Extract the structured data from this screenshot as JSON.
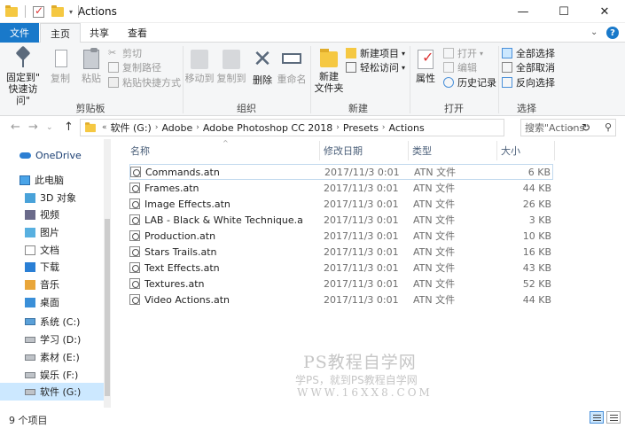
{
  "window": {
    "title": "Actions",
    "minimize": "—",
    "maximize": "☐",
    "close": "✕"
  },
  "tabs": {
    "file": "文件",
    "home": "主页",
    "share": "共享",
    "view": "查看"
  },
  "ribbon": {
    "clipboard": {
      "pin_label_1": "固定到\"",
      "pin_label_2": "快速访问\"",
      "copy": "复制",
      "paste": "粘贴",
      "cut": "剪切",
      "copy_path": "复制路径",
      "paste_shortcut": "粘贴快捷方式",
      "group": "剪贴板"
    },
    "organize": {
      "move_to": "移动到",
      "copy_to": "复制到",
      "delete": "删除",
      "rename": "重命名",
      "group": "组织"
    },
    "new": {
      "new_folder_1": "新建",
      "new_folder_2": "文件夹",
      "new_item": "新建项目",
      "easy_access": "轻松访问",
      "group": "新建"
    },
    "open": {
      "properties": "属性",
      "open": "打开",
      "edit": "编辑",
      "history": "历史记录",
      "group": "打开"
    },
    "select": {
      "select_all": "全部选择",
      "select_none": "全部取消",
      "invert": "反向选择",
      "group": "选择"
    }
  },
  "address": {
    "crumbs": [
      "软件 (G:)",
      "Adobe",
      "Adobe Photoshop CC 2018",
      "Presets",
      "Actions"
    ],
    "search_placeholder": "搜索\"Actions\""
  },
  "nav": [
    {
      "label": "OneDrive",
      "icon": "cloud"
    },
    {
      "label": "此电脑",
      "icon": "pc"
    },
    {
      "label": "3D 对象",
      "icon": "fold3d"
    },
    {
      "label": "视频",
      "icon": "fold-vid"
    },
    {
      "label": "图片",
      "icon": "fold-pic"
    },
    {
      "label": "文档",
      "icon": "fold-doc"
    },
    {
      "label": "下载",
      "icon": "fold-dl"
    },
    {
      "label": "音乐",
      "icon": "fold-mus"
    },
    {
      "label": "桌面",
      "icon": "fold-desk"
    },
    {
      "label": "系统 (C:)",
      "icon": "drive-c"
    },
    {
      "label": "学习 (D:)",
      "icon": "drive"
    },
    {
      "label": "素材 (E:)",
      "icon": "drive"
    },
    {
      "label": "娱乐 (F:)",
      "icon": "drive"
    },
    {
      "label": "软件 (G:)",
      "icon": "drive",
      "selected": true
    }
  ],
  "columns": {
    "name": "名称",
    "date": "修改日期",
    "type": "类型",
    "size": "大小"
  },
  "files": [
    {
      "name": "Commands.atn",
      "date": "2017/11/3 0:01",
      "type": "ATN 文件",
      "size": "6 KB"
    },
    {
      "name": "Frames.atn",
      "date": "2017/11/3 0:01",
      "type": "ATN 文件",
      "size": "44 KB"
    },
    {
      "name": "Image Effects.atn",
      "date": "2017/11/3 0:01",
      "type": "ATN 文件",
      "size": "26 KB"
    },
    {
      "name": "LAB - Black & White Technique.atn",
      "date": "2017/11/3 0:01",
      "type": "ATN 文件",
      "size": "3 KB"
    },
    {
      "name": "Production.atn",
      "date": "2017/11/3 0:01",
      "type": "ATN 文件",
      "size": "10 KB"
    },
    {
      "name": "Stars Trails.atn",
      "date": "2017/11/3 0:01",
      "type": "ATN 文件",
      "size": "16 KB"
    },
    {
      "name": "Text Effects.atn",
      "date": "2017/11/3 0:01",
      "type": "ATN 文件",
      "size": "43 KB"
    },
    {
      "name": "Textures.atn",
      "date": "2017/11/3 0:01",
      "type": "ATN 文件",
      "size": "52 KB"
    },
    {
      "name": "Video Actions.atn",
      "date": "2017/11/3 0:01",
      "type": "ATN 文件",
      "size": "44 KB"
    }
  ],
  "watermark": {
    "line1": "PS教程自学网",
    "line2": "学PS，就到PS教程自学网",
    "line3": "WWW.16XX8.COM"
  },
  "status": {
    "count": "9 个项目"
  },
  "colors": {
    "accent": "#1979ca",
    "selection": "#cce8ff"
  }
}
